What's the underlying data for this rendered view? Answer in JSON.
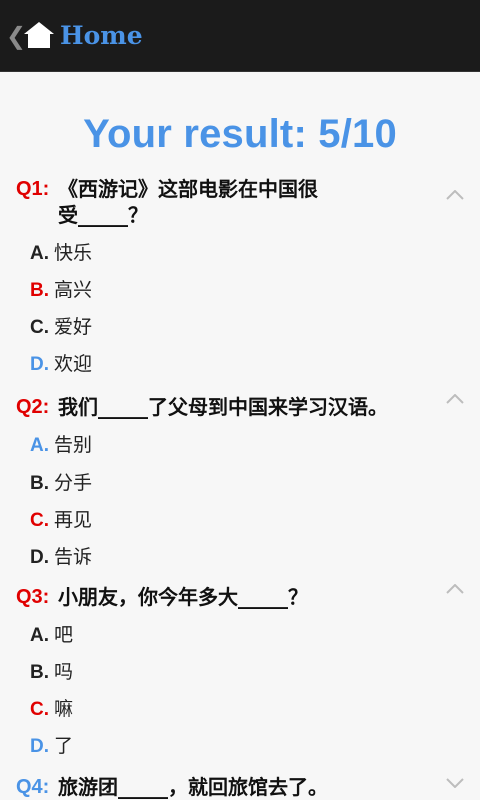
{
  "header": {
    "back_glyph": "❮",
    "title": "Home"
  },
  "result": {
    "text": "Your result: 5/10"
  },
  "questions": [
    {
      "num": "Q1:",
      "text": "《西游记》这部电影在中国很\n受_____？",
      "options": [
        {
          "letter": "A.",
          "text": "快乐",
          "letter_color": "#222222"
        },
        {
          "letter": "B.",
          "text": "高兴",
          "letter_color": "#e00000"
        },
        {
          "letter": "C.",
          "text": "爱好",
          "letter_color": "#222222"
        },
        {
          "letter": "D.",
          "text": "欢迎",
          "letter_color": "#4a93e6"
        }
      ]
    },
    {
      "num": "Q2:",
      "text": "我们_____了父母到中国来学习汉语。",
      "options": [
        {
          "letter": "A.",
          "text": "告别",
          "letter_color": "#4a93e6"
        },
        {
          "letter": "B.",
          "text": "分手",
          "letter_color": "#222222"
        },
        {
          "letter": "C.",
          "text": "再见",
          "letter_color": "#e00000"
        },
        {
          "letter": "D.",
          "text": "告诉",
          "letter_color": "#222222"
        }
      ]
    },
    {
      "num": "Q3:",
      "text": "小朋友，你今年多大_____？",
      "options": [
        {
          "letter": "A.",
          "text": "吧",
          "letter_color": "#222222"
        },
        {
          "letter": "B.",
          "text": "吗",
          "letter_color": "#222222"
        },
        {
          "letter": "C.",
          "text": "嘛",
          "letter_color": "#e00000"
        },
        {
          "letter": "D.",
          "text": "了",
          "letter_color": "#4a93e6"
        }
      ]
    },
    {
      "num": "Q4:",
      "text": "旅游团_____，就回旅馆去了。",
      "options": []
    }
  ],
  "colors": {
    "accent": "#4a93e6",
    "wrong": "#e00000"
  }
}
